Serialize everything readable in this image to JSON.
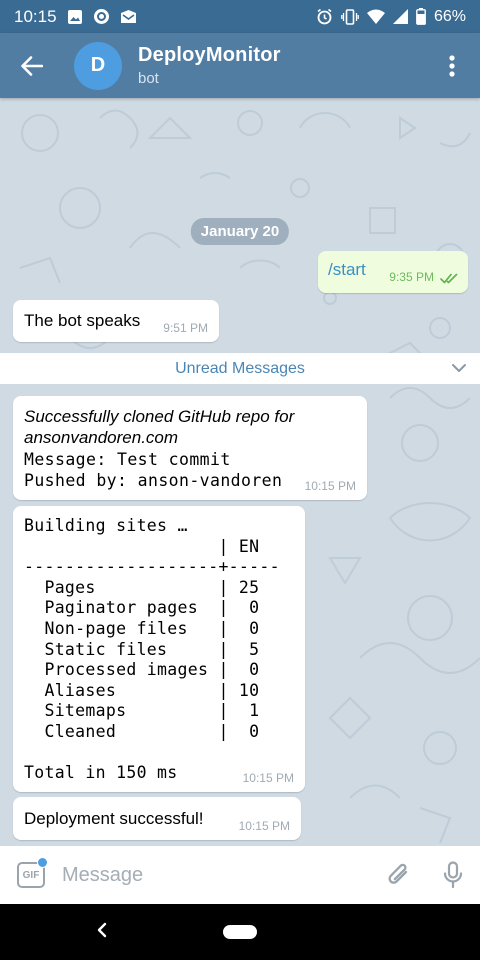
{
  "status_bar": {
    "time": "10:15",
    "battery": "66%"
  },
  "header": {
    "avatar_letter": "D",
    "title": "DeployMonitor",
    "subtitle": "bot",
    "colors": {
      "header": "#527da3",
      "status": "#3a6b93",
      "avatar": "#4d9de0"
    }
  },
  "chat": {
    "date_label": "January 20",
    "unread_label": "Unread Messages",
    "messages": [
      {
        "direction": "out",
        "text": "/start",
        "time": "9:35 PM",
        "status": "read-double-check-icon"
      },
      {
        "direction": "in",
        "text": "The bot speaks",
        "time": "9:51 PM"
      },
      {
        "direction": "in",
        "lines": [
          "Successfully cloned GitHub repo for",
          "ansonvandoren.com",
          "Message: Test commit",
          "Pushed by: anson-vandoren"
        ],
        "time": "10:15 PM"
      },
      {
        "direction": "in",
        "block": "Building sites …\n                   | EN\n-------------------+-----\n  Pages            | 25\n  Paginator pages  |  0\n  Non-page files   |  0\n  Static files     |  5\n  Processed images |  0\n  Aliases          | 10\n  Sitemaps         |  1\n  Cleaned          |  0\n\nTotal in 150 ms",
        "time": "10:15 PM"
      },
      {
        "direction": "in",
        "text": "Deployment successful!",
        "time": "10:15 PM"
      }
    ]
  },
  "input": {
    "placeholder": "Message",
    "gif_label": "GIF"
  },
  "icons": {
    "back": "arrow-left-icon",
    "menu": "more-vertical-icon",
    "attach": "paperclip-icon",
    "mic": "microphone-icon",
    "chevron": "chevron-down-icon"
  }
}
